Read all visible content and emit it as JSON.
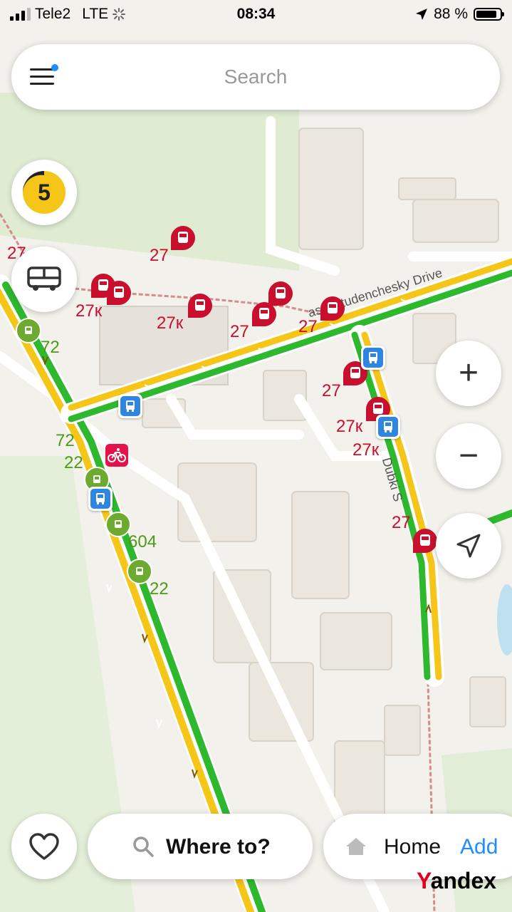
{
  "status_bar": {
    "carrier": "Tele2",
    "network": "LTE",
    "time": "08:34",
    "battery_percent": "88 %",
    "battery_level": 0.88,
    "signal_bars": 3,
    "location_icon": "location-arrow-icon",
    "loading_icon": "loading-spinner-icon"
  },
  "search": {
    "placeholder": "Search",
    "menu_icon": "hamburger-menu-icon"
  },
  "traffic": {
    "score": "5",
    "color": "#f5c518"
  },
  "transport_button": {
    "icon": "bus-icon"
  },
  "map": {
    "street_labels": [
      "asnostudenchesky Drive",
      "Dubki S"
    ],
    "tram_labels": [
      "27",
      "27",
      "27к",
      "27к",
      "27",
      "27",
      "27",
      "27к",
      "27к",
      "27"
    ],
    "bus_labels": [
      "72",
      "72",
      "22",
      "604",
      "22"
    ],
    "colors": {
      "tram": "#c8102e",
      "bus": "#6cab2f",
      "traffic_green": "#2eb82e",
      "traffic_yellow": "#f5c518",
      "stop": "#2f86e0",
      "bike": "#e3124b"
    }
  },
  "controls": {
    "zoom_in": "+",
    "zoom_out": "−",
    "zoom_in_icon": "plus-icon",
    "zoom_out_icon": "minus-icon",
    "locate_icon": "navigation-arrow-icon"
  },
  "bottom_bar": {
    "favorites_icon": "heart-icon",
    "where_to": "Where to?",
    "where_to_icon": "search-icon",
    "home_label": "Home",
    "home_icon": "home-icon",
    "add_label": "Add",
    "accent": "#1f8cff"
  },
  "logo": {
    "first_letter": "Y",
    "rest": "andex"
  }
}
